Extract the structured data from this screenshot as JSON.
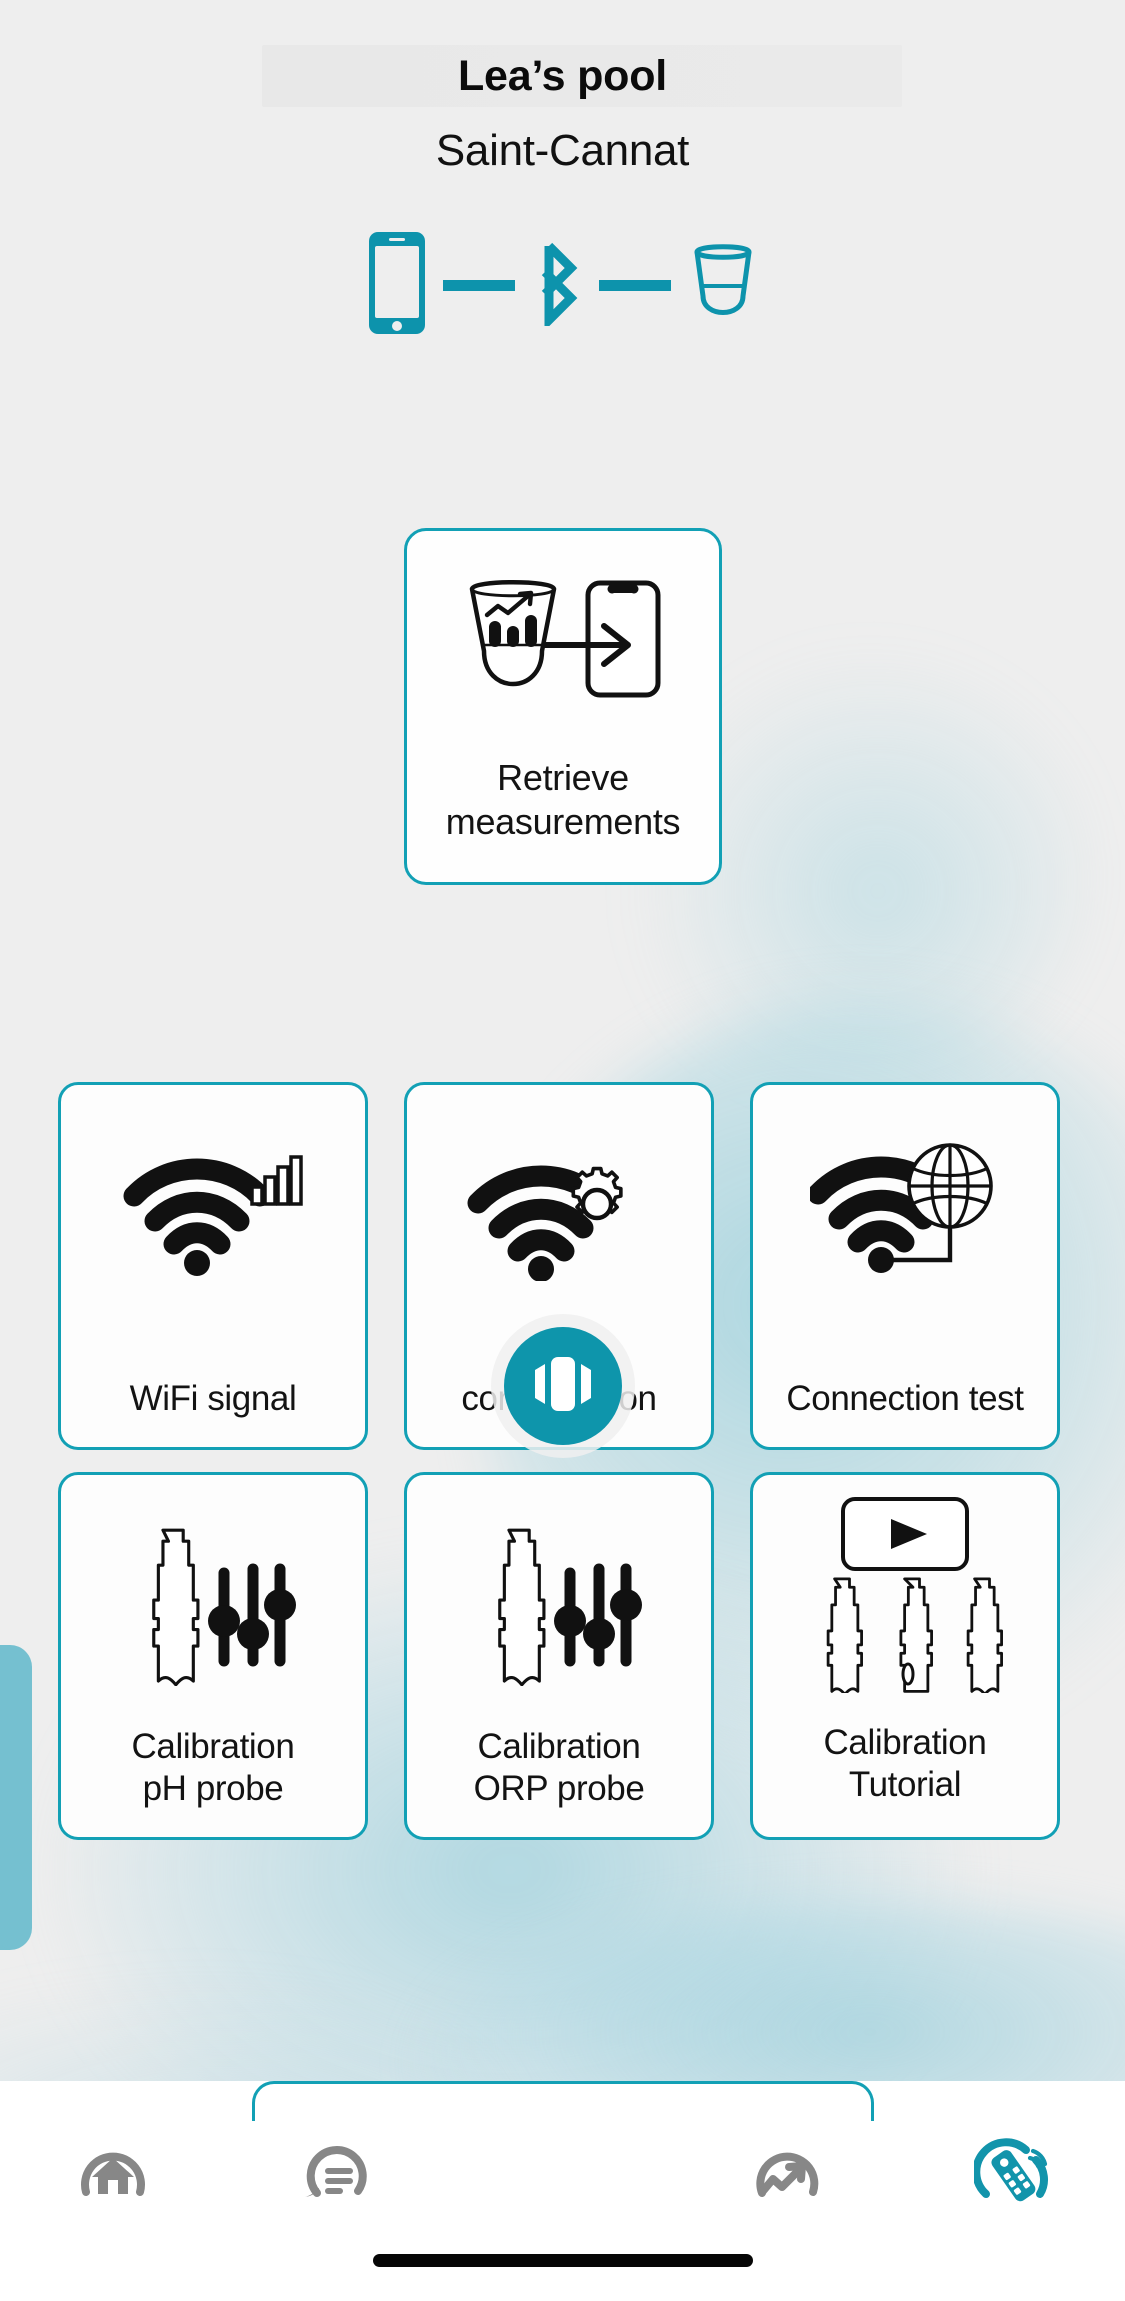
{
  "theme": {
    "accent": "#12a0b5",
    "accent_deep": "#0d93ac",
    "page_bg": "#eeeeee",
    "card_bg": "#fdfdfd",
    "nav_inactive": "#878787",
    "nav_active": "#1294ab",
    "edge_tab": "#75c0d0"
  },
  "header": {
    "pool_name": "Lea’s pool",
    "location": "Saint-Cannat"
  },
  "connection_status": {
    "left_device": "smartphone",
    "link_icon": "bluetooth-icon",
    "right_device": "pool-probe",
    "dash_count": 2
  },
  "primary_action": {
    "label": "Retrieve\nmeasurements",
    "icon": "probe-to-phone-transfer-icon"
  },
  "tiles": [
    {
      "label": "WiFi signal",
      "icon": "wifi-signal-bars-icon",
      "name": "wifi-signal"
    },
    {
      "label": "WiFi\nconfiguration",
      "icon": "wifi-gear-icon",
      "name": "wifi-configuration"
    },
    {
      "label": "Connection test",
      "icon": "wifi-globe-icon",
      "name": "connection-test"
    },
    {
      "label": "Calibration\npH probe",
      "icon": "probe-sliders-icon",
      "name": "calibration-ph-probe"
    },
    {
      "label": "Calibration\nORP probe",
      "icon": "probe-sliders-icon",
      "name": "calibration-orp-probe"
    },
    {
      "label": "Calibration\nTutorial",
      "icon": "play-probes-icon",
      "name": "calibration-tutorial"
    }
  ],
  "bottom_nav": {
    "items": [
      {
        "name": "home",
        "icon": "home-icon",
        "active": false
      },
      {
        "name": "messages",
        "icon": "chat-bubble-icon",
        "active": false
      },
      {
        "name": "analytics",
        "icon": "gauge-trend-icon",
        "active": false
      },
      {
        "name": "remote",
        "icon": "remote-control-icon",
        "active": true
      }
    ],
    "fab": {
      "name": "carousel",
      "icon": "carousel-cards-icon"
    }
  },
  "side_tab": {
    "name": "drawer-handle"
  }
}
